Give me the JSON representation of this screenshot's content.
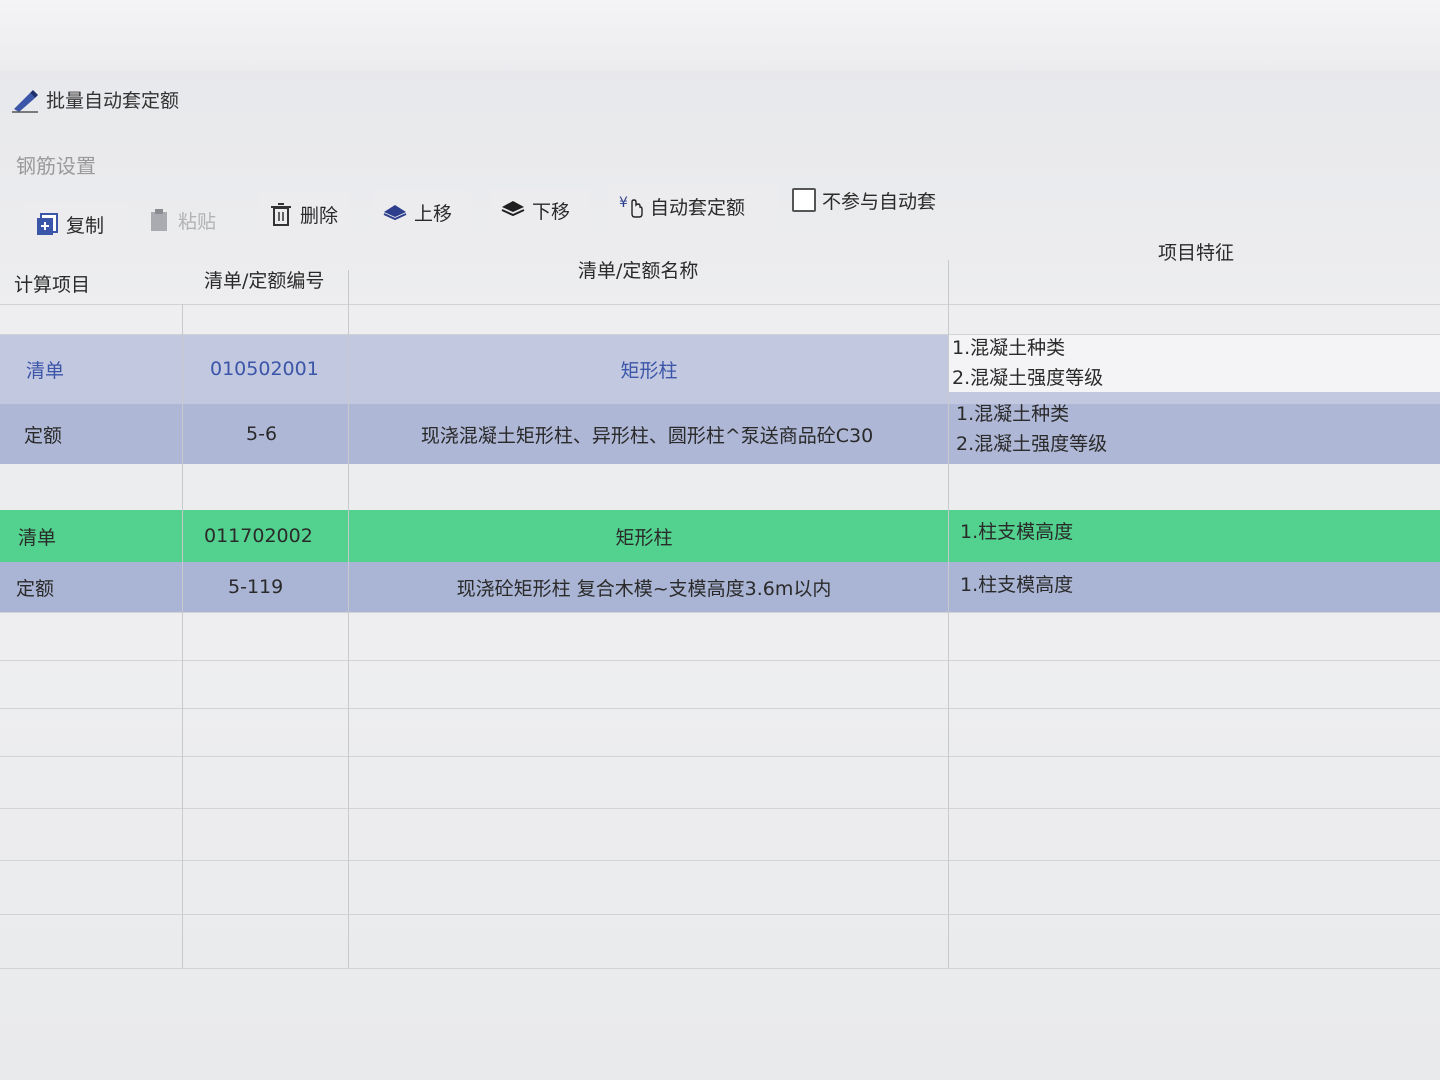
{
  "top_link": {
    "label": "批量自动套定额",
    "icon": "pen-icon"
  },
  "section": {
    "label": "钢筋设置"
  },
  "toolbar": {
    "copy": "复制",
    "paste": "粘贴",
    "delete": "删除",
    "move_up": "上移",
    "move_down": "下移",
    "auto_assign": "自动套定额",
    "exclude_checkbox": "不参与自动套"
  },
  "table": {
    "headers": {
      "calc_item": "计算项目",
      "code": "清单/定额编号",
      "name": "清单/定额名称",
      "features": "项目特征"
    },
    "rows": [
      {
        "type": "清单",
        "code": "010502001",
        "name": "矩形柱",
        "features": [
          "1.混凝土种类",
          "2.混凝土强度等级"
        ]
      },
      {
        "type": "定额",
        "code": "5-6",
        "name": "现浇混凝土矩形柱、异形柱、圆形柱^泵送商品砼C30",
        "features": [
          "1.混凝土种类",
          "2.混凝土强度等级"
        ]
      },
      {
        "type": "清单",
        "code": "011702002",
        "name": "矩形柱",
        "features": [
          "1.柱支模高度"
        ]
      },
      {
        "type": "定额",
        "code": "5-119",
        "name": "现浇砼矩形柱 复合木模~支模高度3.6m以内",
        "features": [
          "1.柱支模高度"
        ]
      }
    ]
  },
  "colors": {
    "bill_row_1": "#c2c8e0",
    "quota_row": "#aeb7d6",
    "bill_row_selected": "#52d28e",
    "accent_text": "#3b55a8"
  }
}
